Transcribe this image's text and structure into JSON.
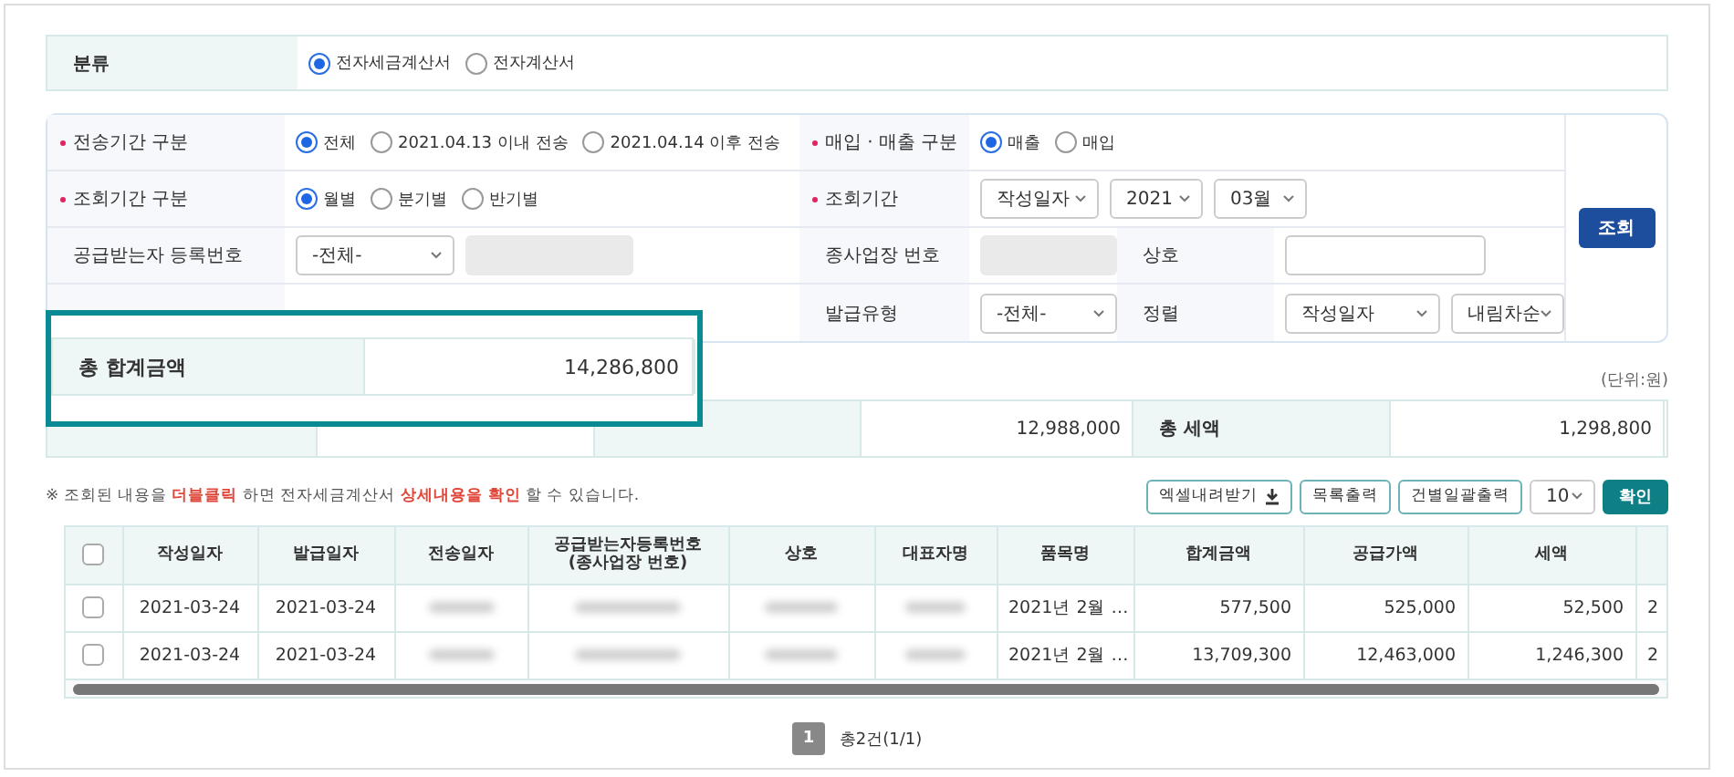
{
  "category": {
    "label": "분류",
    "options": [
      {
        "label": "전자세금계산서",
        "selected": true
      },
      {
        "label": "전자계산서",
        "selected": false
      }
    ]
  },
  "filters": {
    "send_period": {
      "label": "전송기간 구분",
      "required": true,
      "options": [
        {
          "label": "전체",
          "selected": true
        },
        {
          "label": "2021.04.13 이내 전송",
          "selected": false
        },
        {
          "label": "2021.04.14 이후 전송",
          "selected": false
        }
      ]
    },
    "trade_type": {
      "label": "매입 · 매출 구분",
      "required": true,
      "options": [
        {
          "label": "매출",
          "selected": true
        },
        {
          "label": "매입",
          "selected": false
        }
      ]
    },
    "query_period_type": {
      "label": "조회기간 구분",
      "required": true,
      "options": [
        {
          "label": "월별",
          "selected": true
        },
        {
          "label": "분기별",
          "selected": false
        },
        {
          "label": "반기별",
          "selected": false
        }
      ]
    },
    "query_period": {
      "label": "조회기간",
      "required": true,
      "selects": [
        "작성일자",
        "2021",
        "03월"
      ]
    },
    "buyer_reg_no": {
      "label": "공급받는자 등록번호",
      "select": "-전체-"
    },
    "branch_no": {
      "label": "종사업장 번호"
    },
    "company": {
      "label": "상호"
    },
    "issue_type": {
      "label": "발급유형",
      "select": "-전체-"
    },
    "sort": {
      "label": "정렬",
      "selects": [
        "작성일자",
        "내림차순"
      ]
    },
    "search_button": "조회"
  },
  "unit": "(단위:원)",
  "summary": [
    {
      "value": "12,988,000"
    },
    {
      "label": "총 세액",
      "value": "1,298,800"
    }
  ],
  "callout": {
    "label": "총 합계금액",
    "value": "14,286,800"
  },
  "note": "※ 조회된 내용을 **더블클릭** 하면 전자세금계산서 **상세내용을 확인** 할 수 있습니다.",
  "actions": {
    "excel": "엑셀내려받기",
    "print_list": "목록출력",
    "print_each": "건별일괄출력",
    "page_size": "10",
    "confirm": "확인"
  },
  "table": {
    "all_checked": false,
    "columns": [
      "작성일자",
      "발급일자",
      "전송일자",
      "공급받는자등록번호\n(종사업장 번호)",
      "상호",
      "대표자명",
      "품목명",
      "합계금액",
      "공급가액",
      "세액",
      ""
    ],
    "rows": [
      {
        "checked": false,
        "cells": [
          "2021-03-24",
          "2021-03-24",
          null,
          null,
          null,
          null,
          "2021년 2월 …",
          "577,500",
          "525,000",
          "52,500",
          "2"
        ]
      },
      {
        "checked": false,
        "cells": [
          "2021-03-24",
          "2021-03-24",
          null,
          null,
          null,
          null,
          "2021년 2월 …",
          "13,709,300",
          "12,463,000",
          "1,246,300",
          "2"
        ]
      }
    ]
  },
  "pagination": {
    "pages": [
      {
        "label": "1",
        "selected": true
      }
    ],
    "total": "총2건(1/1)"
  }
}
